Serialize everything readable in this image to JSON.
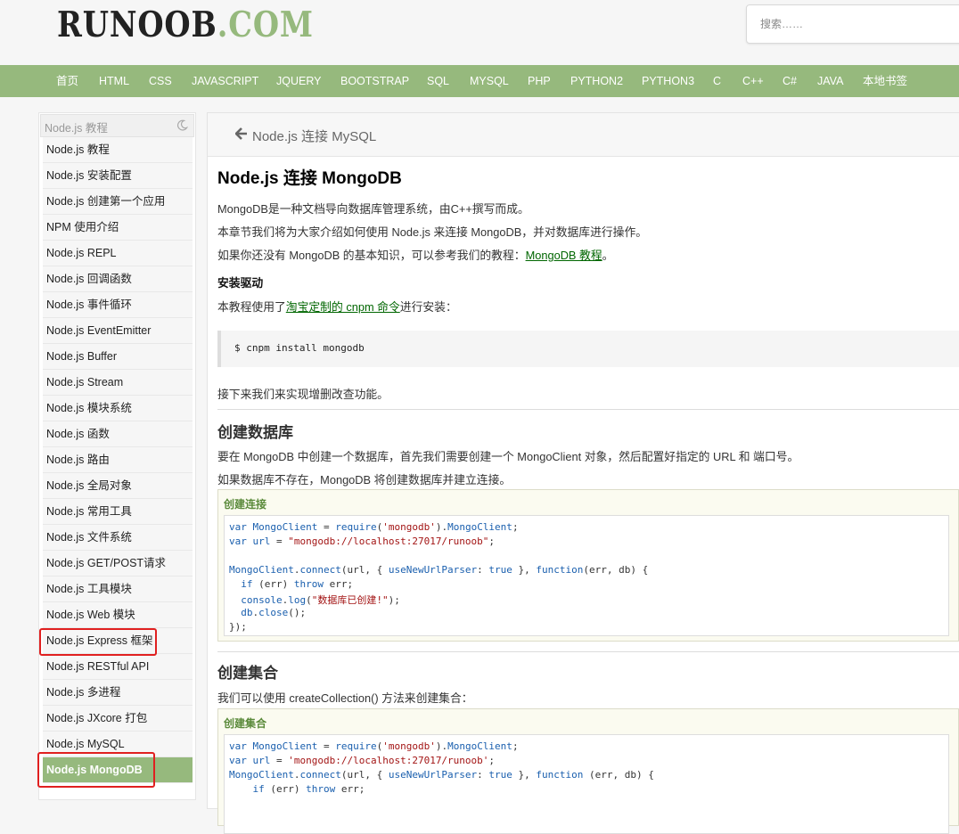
{
  "header": {
    "logo_part1": "RUNOOB",
    "logo_part2": ".COM",
    "search_placeholder": "搜索……"
  },
  "nav": [
    "首页",
    "HTML",
    "CSS",
    "JAVASCRIPT",
    "JQUERY",
    "BOOTSTRAP",
    "SQL",
    "MYSQL",
    "PHP",
    "PYTHON2",
    "PYTHON3",
    "C",
    "C++",
    "C#",
    "JAVA",
    "本地书签"
  ],
  "sidebar": {
    "title": "Node.js 教程",
    "moon_icon": "moon-icon",
    "items": [
      "Node.js 教程",
      "Node.js 安装配置",
      "Node.js 创建第一个应用",
      "NPM 使用介绍",
      "Node.js REPL",
      "Node.js 回调函数",
      "Node.js 事件循环",
      "Node.js EventEmitter",
      "Node.js Buffer",
      "Node.js Stream",
      "Node.js 模块系统",
      "Node.js 函数",
      "Node.js 路由",
      "Node.js 全局对象",
      "Node.js 常用工具",
      "Node.js 文件系统",
      "Node.js GET/POST请求",
      "Node.js 工具模块",
      "Node.js Web 模块",
      "Node.js Express 框架",
      "Node.js RESTful API",
      "Node.js 多进程",
      "Node.js JXcore 打包",
      "Node.js MySQL",
      "Node.js MongoDB"
    ],
    "active_index": 24,
    "highlight_color": "#96b97d"
  },
  "content": {
    "prev_link": "Node.js 连接 MySQL",
    "title": "Node.js 连接 MongoDB",
    "intro1": "MongoDB是一种文档导向数据库管理系统，由C++撰写而成。",
    "intro2": "本章节我们将为大家介绍如何使用 Node.js 来连接 MongoDB，并对数据库进行操作。",
    "intro3_pre": "如果你还没有 MongoDB 的基本知识，可以参考我们的教程：",
    "intro3_link": "MongoDB 教程",
    "intro3_post": "。",
    "driver_heading": "安装驱动",
    "driver_pre": "本教程使用了",
    "driver_link": "淘宝定制的 cnpm 命令",
    "driver_post": "进行安装：",
    "cmd": "$ cnpm install mongodb",
    "crud_text": "接下来我们来实现增删改查功能。",
    "sec1_title": "创建数据库",
    "sec1_p1": "要在 MongoDB 中创建一个数据库，首先我们需要创建一个 MongoClient 对象，然后配置好指定的 URL 和 端口号。",
    "sec1_p2": "如果数据库不存在，MongoDB 将创建数据库并建立连接。",
    "example1_title": "创建连接",
    "sec2_title": "创建集合",
    "sec2_p1": "我们可以使用 createCollection() 方法来创建集合：",
    "example2_title": "创建集合"
  },
  "colors": {
    "brand": "#96b97d",
    "link": "#006600",
    "highlight_box": "#e02020"
  }
}
